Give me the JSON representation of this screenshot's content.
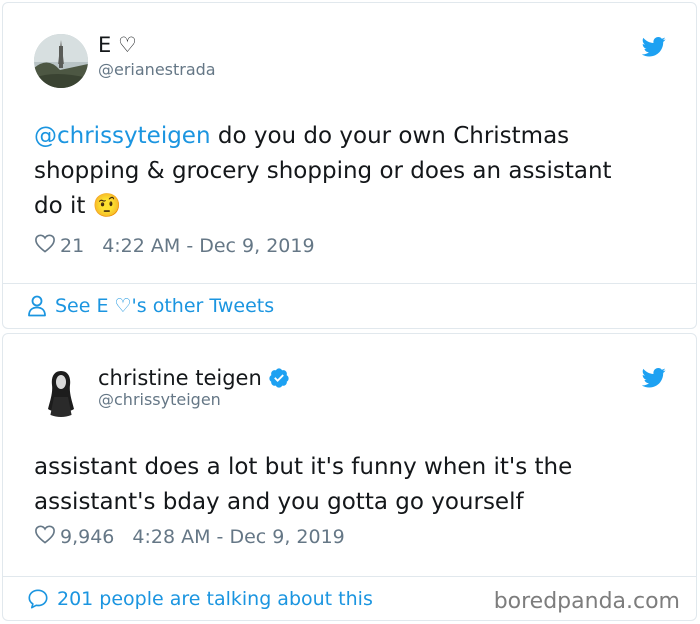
{
  "tweets": [
    {
      "display_name": "E ♡",
      "handle": "@erianestrada",
      "mention": "@chrissyteigen",
      "text_after_mention": " do you do your own Christmas\nshopping & grocery shopping or does an assistant\ndo it ",
      "emoji": "🤨",
      "likes": "21",
      "timestamp": "4:22 AM - Dec 9, 2019",
      "footer": "See E ♡'s other Tweets"
    },
    {
      "display_name": "christine teigen",
      "verified": true,
      "handle": "@chrissyteigen",
      "text": "assistant does a lot but it's funny when it's the\nassistant's bday and you gotta go yourself",
      "likes": "9,946",
      "timestamp": "4:28 AM - Dec 9, 2019",
      "footer": "201 people are talking about this"
    }
  ],
  "watermark": "boredpanda.com",
  "colors": {
    "link": "#1b95e0",
    "muted": "#657786",
    "border": "#e1e8ed",
    "twitter_blue": "#1da1f2"
  }
}
